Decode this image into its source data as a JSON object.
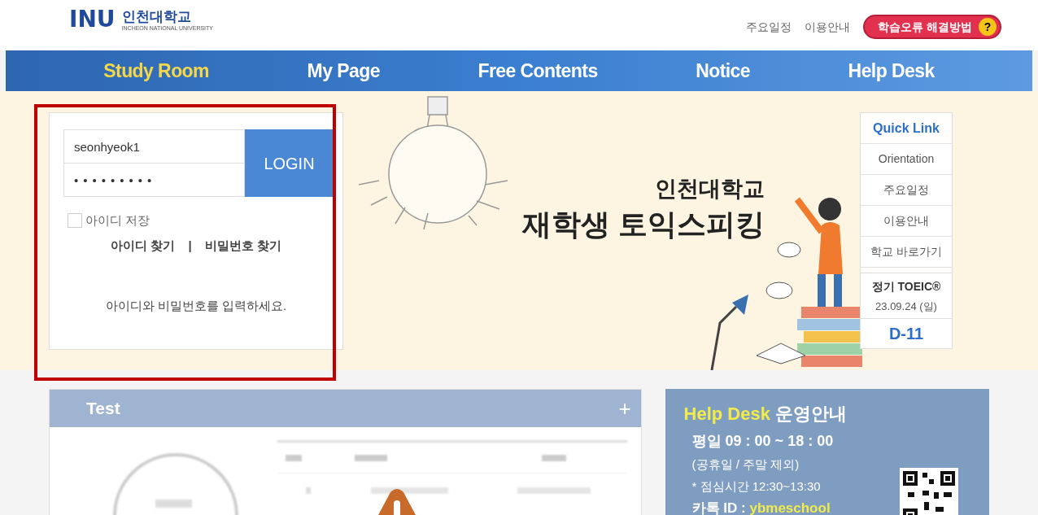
{
  "header": {
    "logo_letters": "INU",
    "logo_name": "인천대학교",
    "logo_subtitle": "INCHEON NATIONAL UNIVERSITY",
    "links": [
      "주요일정",
      "이용안내"
    ],
    "help_button": "학습오류 해결방법",
    "help_badge": "?"
  },
  "nav": [
    {
      "label": "Study Room",
      "selected": true
    },
    {
      "label": "My Page",
      "selected": false
    },
    {
      "label": "Free Contents",
      "selected": false
    },
    {
      "label": "Notice",
      "selected": false
    },
    {
      "label": "Help Desk",
      "selected": false
    }
  ],
  "login": {
    "username": "seonhyeok1",
    "password": "•••••••••",
    "button": "LOGIN",
    "remember": {
      "label": "아이디 저장",
      "checked": false
    },
    "find_id": "아이디 찾기",
    "separator": "|",
    "find_password": "비밀번호 찾기",
    "message": "아이디와 비밀번호를 입력하세요."
  },
  "banner": {
    "school": "인천대학교",
    "title": "재학생 토익스피킹"
  },
  "quick_link": {
    "title": "Quick Link",
    "items": [
      "Orientation",
      "주요일정",
      "이용안내",
      "학교 바로가기"
    ],
    "exam_title": "정기 TOEIC®",
    "exam_date": "23.09.24 (일)",
    "countdown": "D-11"
  },
  "test_panel": {
    "title": "Test",
    "more": "+"
  },
  "help_desk": {
    "title_highlight": "Help Desk",
    "title_rest": "운영안내",
    "hours": "평일 09 : 00 ~ 18 : 00",
    "note": "(공휴일 / 주말 제외)",
    "lunch": "* 점심시간 12:30~13:30",
    "kakao_label": "카톡 ID : ",
    "kakao_id": "ybmeschool"
  }
}
